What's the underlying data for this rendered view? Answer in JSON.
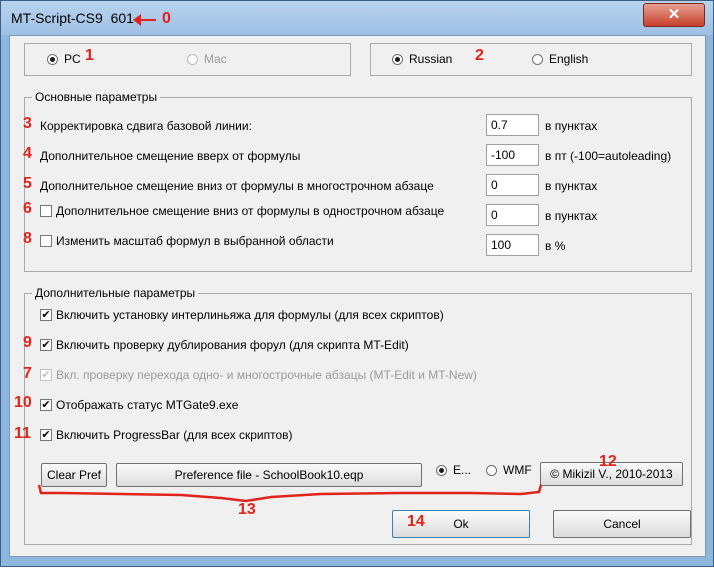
{
  "window": {
    "title": "MT-Script-CS9",
    "version": "601",
    "close": "✕"
  },
  "platform": {
    "pc": "PC",
    "mac": "Mac"
  },
  "language": {
    "russian": "Russian",
    "english": "English"
  },
  "basic": {
    "title": "Основные параметры",
    "rows": [
      {
        "label": "Корректировка сдвига базовой линии:",
        "value": "0.7",
        "unit": "в пунктах"
      },
      {
        "label": "Дополнительное смещение вверх от формулы",
        "value": "-100",
        "unit": "в пт (-100=autoleading)"
      },
      {
        "label": "Дополнительное смещение вниз от формулы в многострочном абзаце",
        "value": "0",
        "unit": "в пунктах"
      },
      {
        "label": "Дополнительное смещение вниз от формулы в однострочном абзаце",
        "value": "0",
        "unit": "в пунктах"
      },
      {
        "label": "Изменить масштаб формул в выбранной области",
        "value": "100",
        "unit": "в %"
      }
    ]
  },
  "extra": {
    "title": "Дополнительные параметры",
    "checks": [
      "Включить установку интерлиньяжа для формулы (для всех скриптов)",
      "Включить проверку дублирования форул (для скрипта MT-Edit)",
      "Вкл. проверку перехода одно- и многострочные абзацы (MT-Edit и MT-New)",
      "Отображать статус MTGate9.exe",
      "Включить ProgressBar (для всех скриптов)"
    ]
  },
  "bottom": {
    "clear_pref": "Clear Pref",
    "pref_file": "Preference file - SchoolBook10.eqp",
    "eps": "E...",
    "wmf": "WMF",
    "copyright": "© Mikizil V., 2010-2013",
    "ok": "Ok",
    "cancel": "Cancel"
  },
  "annotations": {
    "color": "#e0241c",
    "labels": [
      "0",
      "1",
      "2",
      "3",
      "4",
      "5",
      "6",
      "7",
      "8",
      "9",
      "10",
      "11",
      "12",
      "13",
      "14"
    ]
  }
}
